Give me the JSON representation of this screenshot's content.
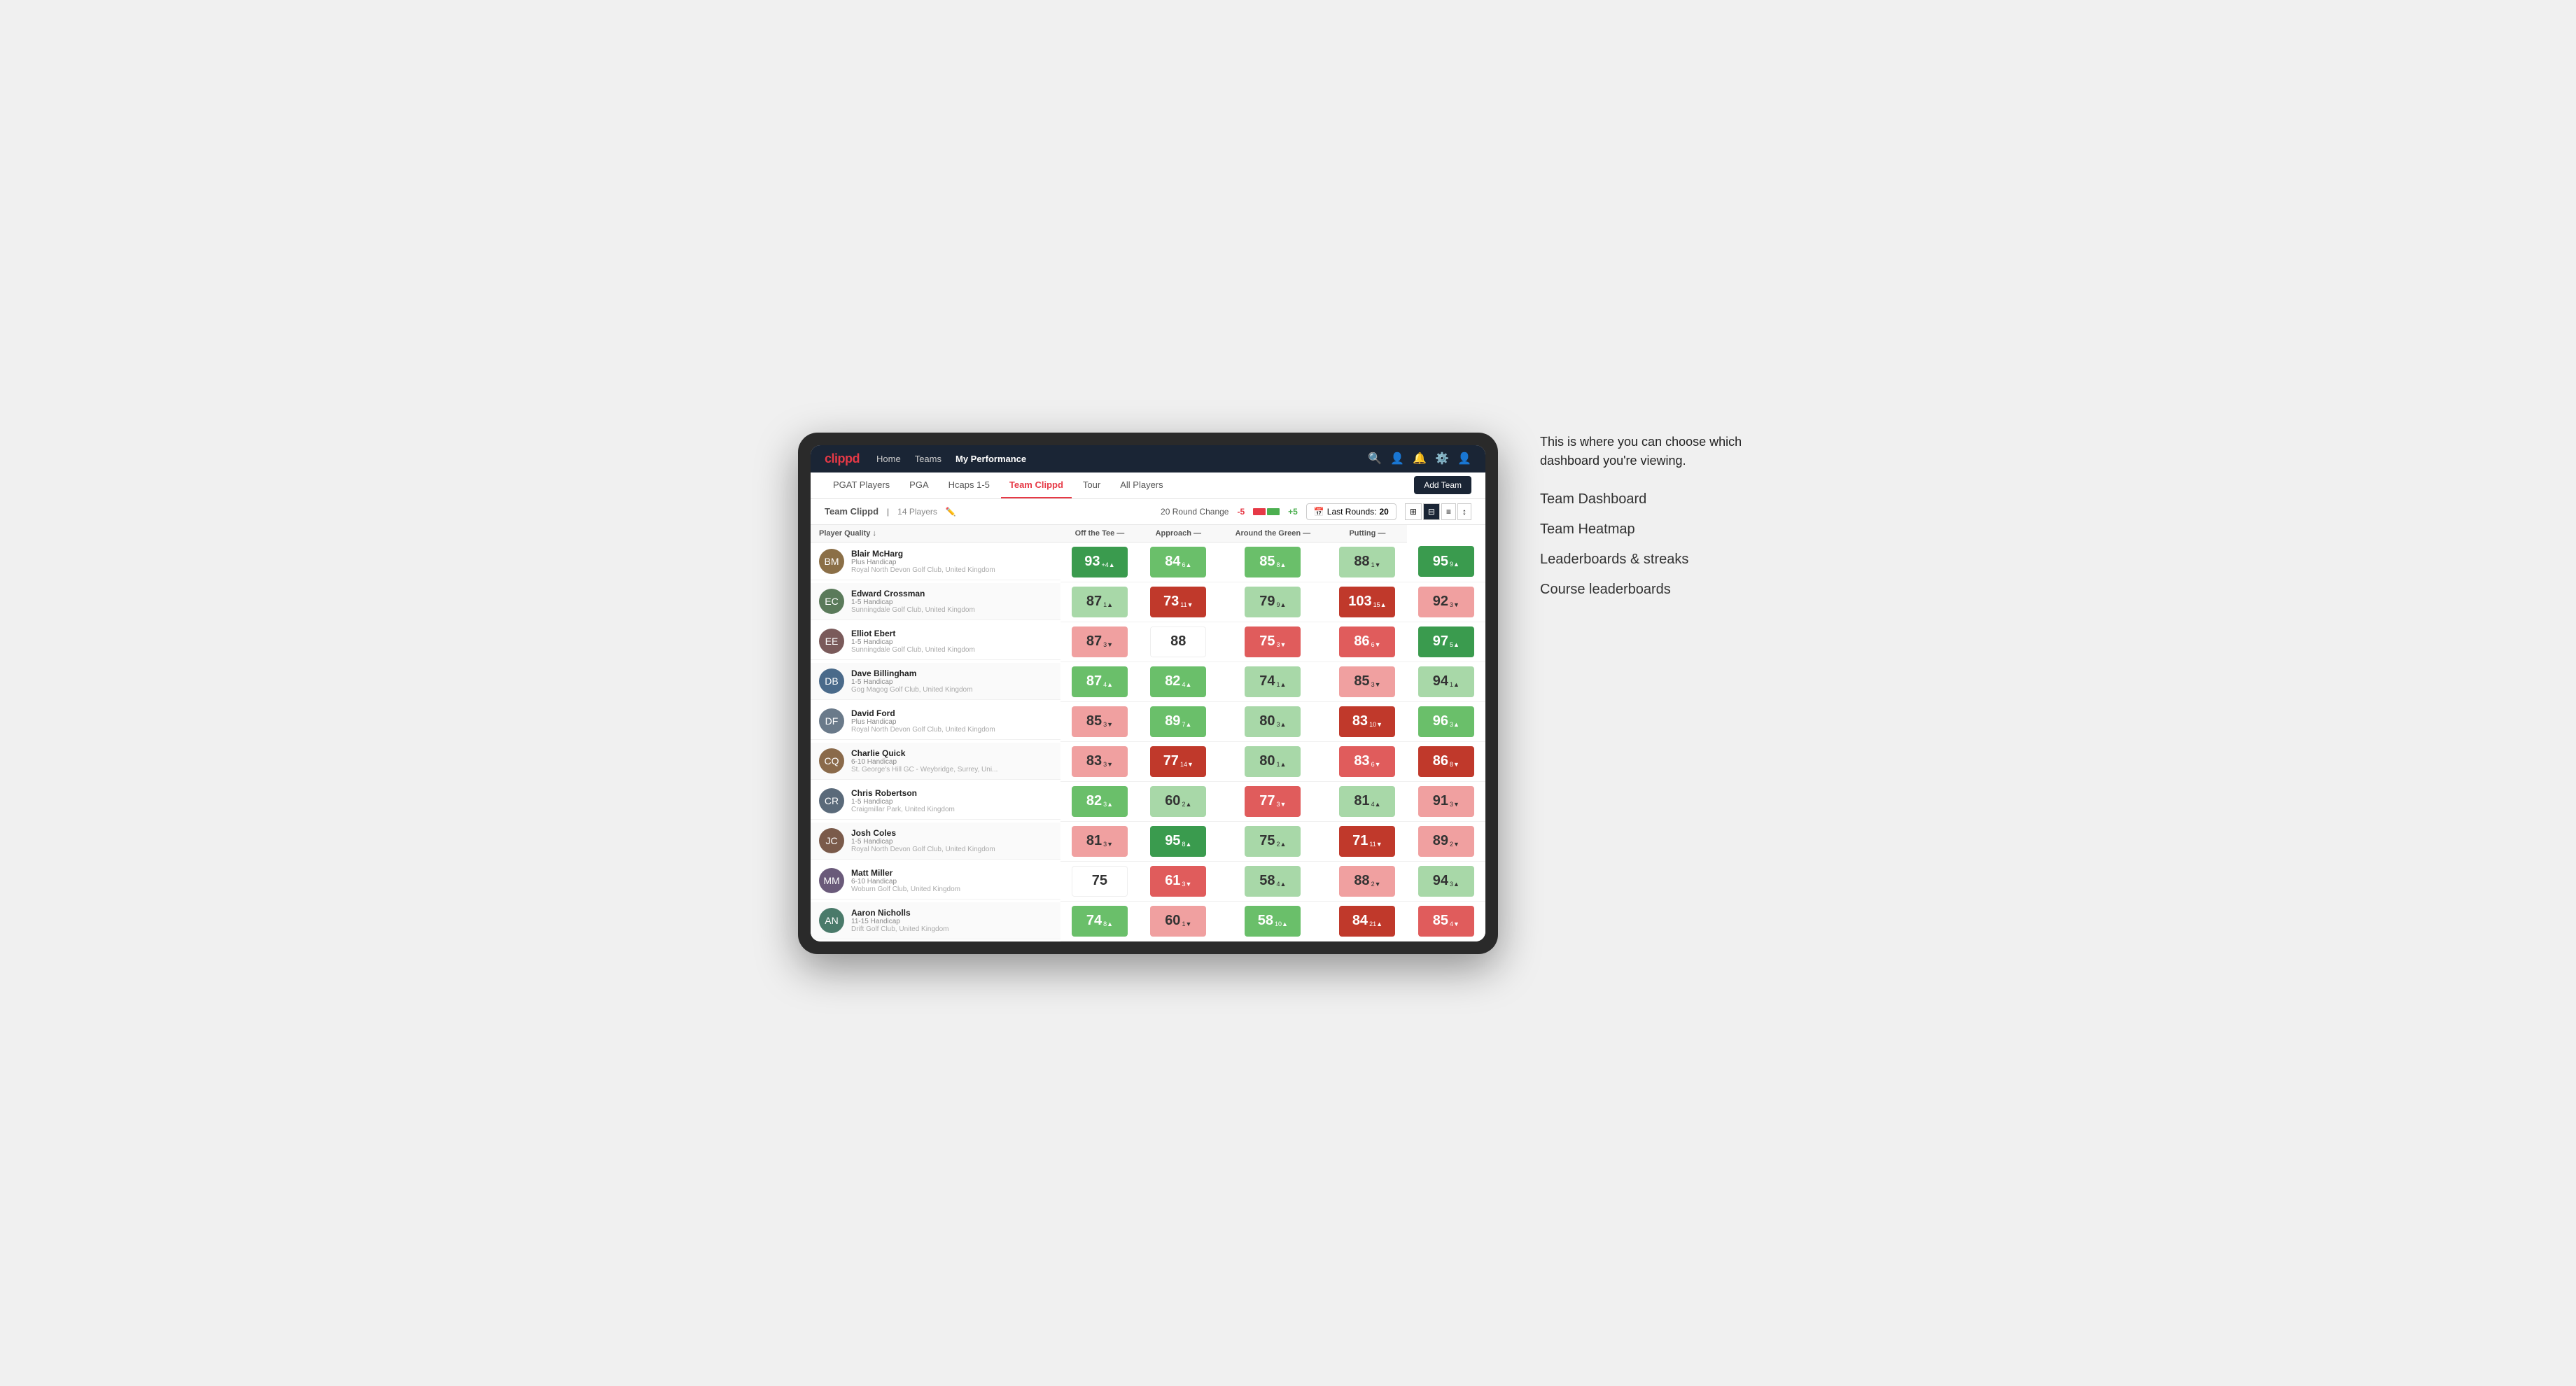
{
  "annotation": {
    "callout": "This is where you can choose which dashboard you're viewing.",
    "items": [
      "Team Dashboard",
      "Team Heatmap",
      "Leaderboards & streaks",
      "Course leaderboards"
    ]
  },
  "nav": {
    "logo": "clippd",
    "links": [
      "Home",
      "Teams",
      "My Performance"
    ],
    "active_link": "My Performance"
  },
  "subnav": {
    "links": [
      "PGAT Players",
      "PGA",
      "Hcaps 1-5",
      "Team Clippd",
      "Tour",
      "All Players"
    ],
    "active_link": "Team Clippd",
    "add_team_label": "Add Team"
  },
  "toolbar": {
    "team_name": "Team Clippd",
    "separator": "|",
    "player_count": "14 Players",
    "round_change_label": "20 Round Change",
    "minus_label": "-5",
    "plus_label": "+5",
    "last_rounds_label": "Last Rounds:",
    "last_rounds_value": "20"
  },
  "table": {
    "headers": {
      "player": "Player Quality ↓",
      "off_tee": "Off the Tee —",
      "approach": "Approach —",
      "around_green": "Around the Green —",
      "putting": "Putting —"
    },
    "rows": [
      {
        "name": "Blair McHarg",
        "handicap": "Plus Handicap",
        "club": "Royal North Devon Golf Club, United Kingdom",
        "avatar_color": "#8B6F47",
        "initials": "BM",
        "quality": {
          "score": 93,
          "change": "+4",
          "dir": "up",
          "bg": "green-dark"
        },
        "off_tee": {
          "score": 84,
          "change": "6",
          "dir": "up",
          "bg": "green-mid"
        },
        "approach": {
          "score": 85,
          "change": "8",
          "dir": "up",
          "bg": "green-mid"
        },
        "around_green": {
          "score": 88,
          "change": "1",
          "dir": "down",
          "bg": "green-light"
        },
        "putting": {
          "score": 95,
          "change": "9",
          "dir": "up",
          "bg": "green-dark"
        }
      },
      {
        "name": "Edward Crossman",
        "handicap": "1-5 Handicap",
        "club": "Sunningdale Golf Club, United Kingdom",
        "avatar_color": "#5a7a5a",
        "initials": "EC",
        "quality": {
          "score": 87,
          "change": "1",
          "dir": "up",
          "bg": "green-light"
        },
        "off_tee": {
          "score": 73,
          "change": "11",
          "dir": "down",
          "bg": "red-dark"
        },
        "approach": {
          "score": 79,
          "change": "9",
          "dir": "up",
          "bg": "green-light"
        },
        "around_green": {
          "score": 103,
          "change": "15",
          "dir": "up",
          "bg": "red-dark"
        },
        "putting": {
          "score": 92,
          "change": "3",
          "dir": "down",
          "bg": "red-light"
        }
      },
      {
        "name": "Elliot Ebert",
        "handicap": "1-5 Handicap",
        "club": "Sunningdale Golf Club, United Kingdom",
        "avatar_color": "#7a5a5a",
        "initials": "EE",
        "quality": {
          "score": 87,
          "change": "3",
          "dir": "down",
          "bg": "red-light"
        },
        "off_tee": {
          "score": 88,
          "change": "",
          "dir": "",
          "bg": "white"
        },
        "approach": {
          "score": 75,
          "change": "3",
          "dir": "down",
          "bg": "red-mid"
        },
        "around_green": {
          "score": 86,
          "change": "6",
          "dir": "down",
          "bg": "red-mid"
        },
        "putting": {
          "score": 97,
          "change": "5",
          "dir": "up",
          "bg": "green-dark"
        }
      },
      {
        "name": "Dave Billingham",
        "handicap": "1-5 Handicap",
        "club": "Gog Magog Golf Club, United Kingdom",
        "avatar_color": "#4a6a8a",
        "initials": "DB",
        "quality": {
          "score": 87,
          "change": "4",
          "dir": "up",
          "bg": "green-mid"
        },
        "off_tee": {
          "score": 82,
          "change": "4",
          "dir": "up",
          "bg": "green-mid"
        },
        "approach": {
          "score": 74,
          "change": "1",
          "dir": "up",
          "bg": "green-light"
        },
        "around_green": {
          "score": 85,
          "change": "3",
          "dir": "down",
          "bg": "red-light"
        },
        "putting": {
          "score": 94,
          "change": "1",
          "dir": "up",
          "bg": "green-light"
        }
      },
      {
        "name": "David Ford",
        "handicap": "Plus Handicap",
        "club": "Royal North Devon Golf Club, United Kingdom",
        "avatar_color": "#6a7a8a",
        "initials": "DF",
        "quality": {
          "score": 85,
          "change": "3",
          "dir": "down",
          "bg": "red-light"
        },
        "off_tee": {
          "score": 89,
          "change": "7",
          "dir": "up",
          "bg": "green-mid"
        },
        "approach": {
          "score": 80,
          "change": "3",
          "dir": "up",
          "bg": "green-light"
        },
        "around_green": {
          "score": 83,
          "change": "10",
          "dir": "down",
          "bg": "red-dark"
        },
        "putting": {
          "score": 96,
          "change": "3",
          "dir": "up",
          "bg": "green-mid"
        }
      },
      {
        "name": "Charlie Quick",
        "handicap": "6-10 Handicap",
        "club": "St. George's Hill GC - Weybridge, Surrey, Uni...",
        "avatar_color": "#8a6a4a",
        "initials": "CQ",
        "quality": {
          "score": 83,
          "change": "3",
          "dir": "down",
          "bg": "red-light"
        },
        "off_tee": {
          "score": 77,
          "change": "14",
          "dir": "down",
          "bg": "red-dark"
        },
        "approach": {
          "score": 80,
          "change": "1",
          "dir": "up",
          "bg": "green-light"
        },
        "around_green": {
          "score": 83,
          "change": "6",
          "dir": "down",
          "bg": "red-mid"
        },
        "putting": {
          "score": 86,
          "change": "8",
          "dir": "down",
          "bg": "red-dark"
        }
      },
      {
        "name": "Chris Robertson",
        "handicap": "1-5 Handicap",
        "club": "Craigmillar Park, United Kingdom",
        "avatar_color": "#5a6a7a",
        "initials": "CR",
        "quality": {
          "score": 82,
          "change": "3",
          "dir": "up",
          "bg": "green-mid"
        },
        "off_tee": {
          "score": 60,
          "change": "2",
          "dir": "up",
          "bg": "green-light"
        },
        "approach": {
          "score": 77,
          "change": "3",
          "dir": "down",
          "bg": "red-mid"
        },
        "around_green": {
          "score": 81,
          "change": "4",
          "dir": "up",
          "bg": "green-light"
        },
        "putting": {
          "score": 91,
          "change": "3",
          "dir": "down",
          "bg": "red-light"
        }
      },
      {
        "name": "Josh Coles",
        "handicap": "1-5 Handicap",
        "club": "Royal North Devon Golf Club, United Kingdom",
        "avatar_color": "#7a5a4a",
        "initials": "JC",
        "quality": {
          "score": 81,
          "change": "3",
          "dir": "down",
          "bg": "red-light"
        },
        "off_tee": {
          "score": 95,
          "change": "8",
          "dir": "up",
          "bg": "green-dark"
        },
        "approach": {
          "score": 75,
          "change": "2",
          "dir": "up",
          "bg": "green-light"
        },
        "around_green": {
          "score": 71,
          "change": "11",
          "dir": "down",
          "bg": "red-dark"
        },
        "putting": {
          "score": 89,
          "change": "2",
          "dir": "down",
          "bg": "red-light"
        }
      },
      {
        "name": "Matt Miller",
        "handicap": "6-10 Handicap",
        "club": "Woburn Golf Club, United Kingdom",
        "avatar_color": "#6a5a7a",
        "initials": "MM",
        "quality": {
          "score": 75,
          "change": "",
          "dir": "",
          "bg": "white"
        },
        "off_tee": {
          "score": 61,
          "change": "3",
          "dir": "down",
          "bg": "red-mid"
        },
        "approach": {
          "score": 58,
          "change": "4",
          "dir": "up",
          "bg": "green-light"
        },
        "around_green": {
          "score": 88,
          "change": "2",
          "dir": "down",
          "bg": "red-light"
        },
        "putting": {
          "score": 94,
          "change": "3",
          "dir": "up",
          "bg": "green-light"
        }
      },
      {
        "name": "Aaron Nicholls",
        "handicap": "11-15 Handicap",
        "club": "Drift Golf Club, United Kingdom",
        "avatar_color": "#4a7a6a",
        "initials": "AN",
        "quality": {
          "score": 74,
          "change": "8",
          "dir": "up",
          "bg": "green-mid"
        },
        "off_tee": {
          "score": 60,
          "change": "1",
          "dir": "down",
          "bg": "red-light"
        },
        "approach": {
          "score": 58,
          "change": "10",
          "dir": "up",
          "bg": "green-mid"
        },
        "around_green": {
          "score": 84,
          "change": "21",
          "dir": "up",
          "bg": "red-dark"
        },
        "putting": {
          "score": 85,
          "change": "4",
          "dir": "down",
          "bg": "red-mid"
        }
      }
    ]
  }
}
